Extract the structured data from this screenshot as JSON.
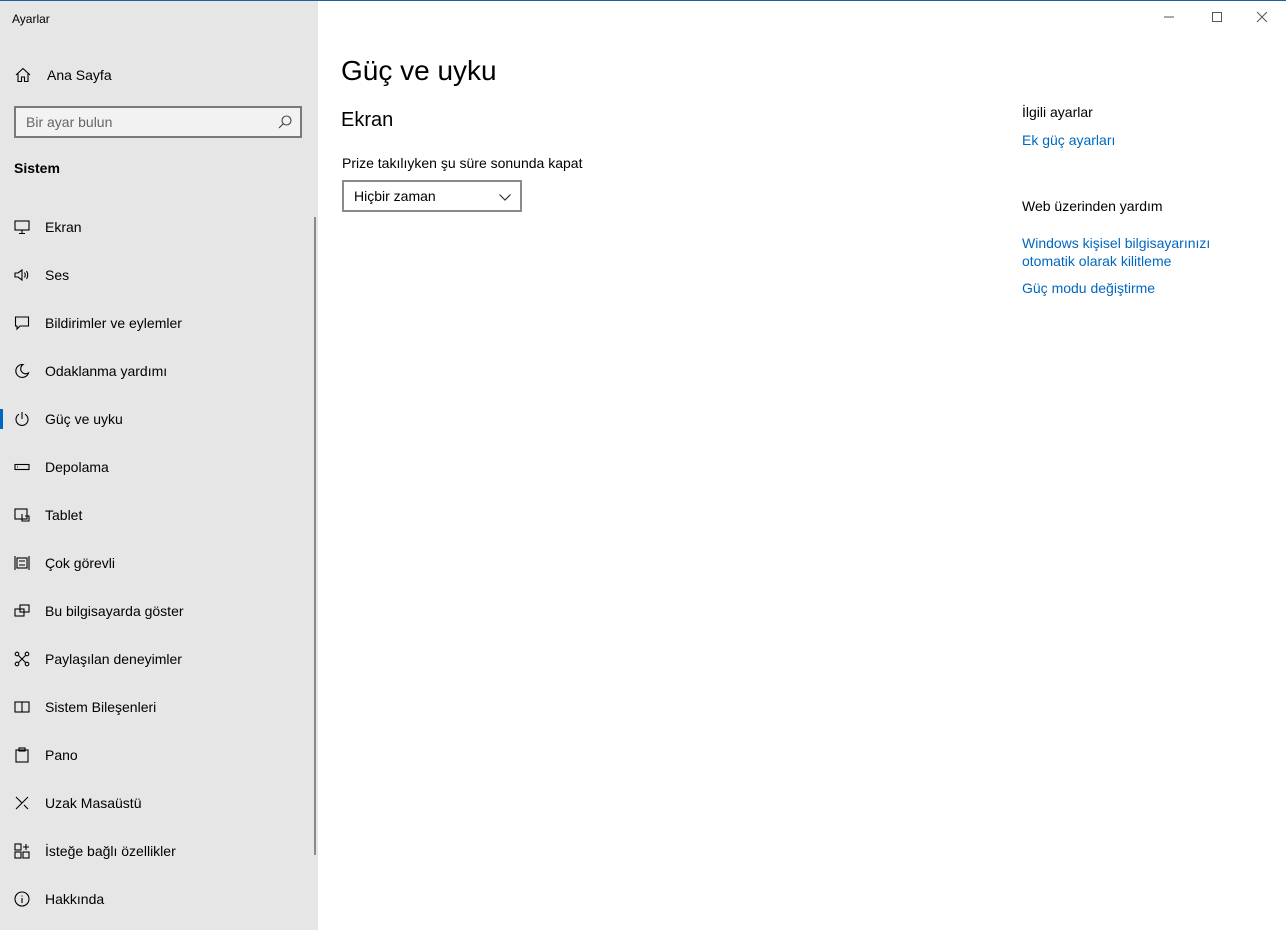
{
  "window": {
    "title": "Ayarlar"
  },
  "sidebar": {
    "home_label": "Ana Sayfa",
    "search_placeholder": "Bir ayar bulun",
    "section_label": "Sistem",
    "items": [
      {
        "label": "Ekran",
        "icon": "monitor-icon"
      },
      {
        "label": "Ses",
        "icon": "speaker-icon"
      },
      {
        "label": "Bildirimler ve eylemler",
        "icon": "notification-icon"
      },
      {
        "label": "Odaklanma yardımı",
        "icon": "moon-icon"
      },
      {
        "label": "Güç ve uyku",
        "icon": "power-icon",
        "selected": true
      },
      {
        "label": "Depolama",
        "icon": "storage-icon"
      },
      {
        "label": "Tablet",
        "icon": "tablet-icon"
      },
      {
        "label": "Çok görevli",
        "icon": "multitask-icon"
      },
      {
        "label": "Bu bilgisayarda göster",
        "icon": "project-icon"
      },
      {
        "label": "Paylaşılan deneyimler",
        "icon": "shared-icon"
      },
      {
        "label": "Sistem Bileşenleri",
        "icon": "components-icon"
      },
      {
        "label": "Pano",
        "icon": "clipboard-icon"
      },
      {
        "label": "Uzak Masaüstü",
        "icon": "remote-desktop-icon"
      },
      {
        "label": "İsteğe bağlı özellikler",
        "icon": "optional-features-icon"
      },
      {
        "label": "Hakkında",
        "icon": "info-icon"
      }
    ]
  },
  "main": {
    "title": "Güç ve uyku",
    "section_title": "Ekran",
    "screen_off_label": "Prize takılıyken şu süre sonunda kapat",
    "screen_off_value": "Hiçbir zaman"
  },
  "related": {
    "heading": "İlgili ayarlar",
    "link_power": "Ek güç ayarları",
    "web_help_heading": "Web üzerinden yardım",
    "link_lock": "Windows kişisel bilgisayarınızı otomatik olarak kilitleme",
    "link_power_mode": "Güç modu değiştirme"
  },
  "colors": {
    "accent": "#0067c0",
    "sidebar_bg": "#e6e6e6"
  }
}
